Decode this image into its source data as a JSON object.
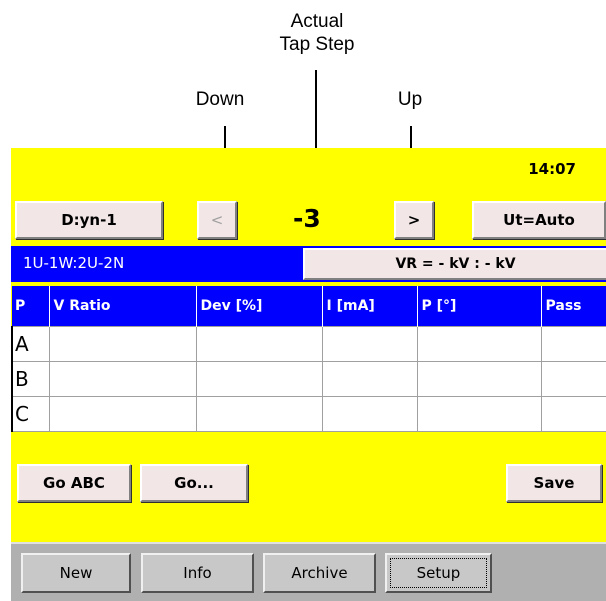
{
  "annotations": {
    "actual_tap_step_line1": "Actual",
    "actual_tap_step_line2": "Tap Step",
    "down": "Down",
    "up": "Up"
  },
  "screen": {
    "clock": "14:07",
    "vector_group_button": "D:yn-1",
    "down_button": "<",
    "tap_step_value": "-3",
    "up_button": ">",
    "voltage_mode_button": "Ut=Auto",
    "wiring": "1U-1W:2U-2N",
    "vr_field": "VR = - kV : - kV",
    "table": {
      "headers": [
        "P",
        "V Ratio",
        "Dev [%]",
        "I [mA]",
        "P [°]",
        "Pass"
      ],
      "rows": [
        [
          "A",
          "",
          "",
          "",
          "",
          ""
        ],
        [
          "B",
          "",
          "",
          "",
          "",
          ""
        ],
        [
          "C",
          "",
          "",
          "",
          "",
          ""
        ]
      ]
    },
    "go_abc_button": "Go ABC",
    "go_button": "Go...",
    "save_button": "Save",
    "taskbar": [
      "New",
      "Info",
      "Archive",
      "Setup"
    ],
    "active_tab": "Setup"
  },
  "colors": {
    "screen_background": "#ffff00",
    "header_blue": "#0000ff",
    "button_face": "#f2e6e6",
    "taskbar_gray": "#b0b0b0"
  }
}
